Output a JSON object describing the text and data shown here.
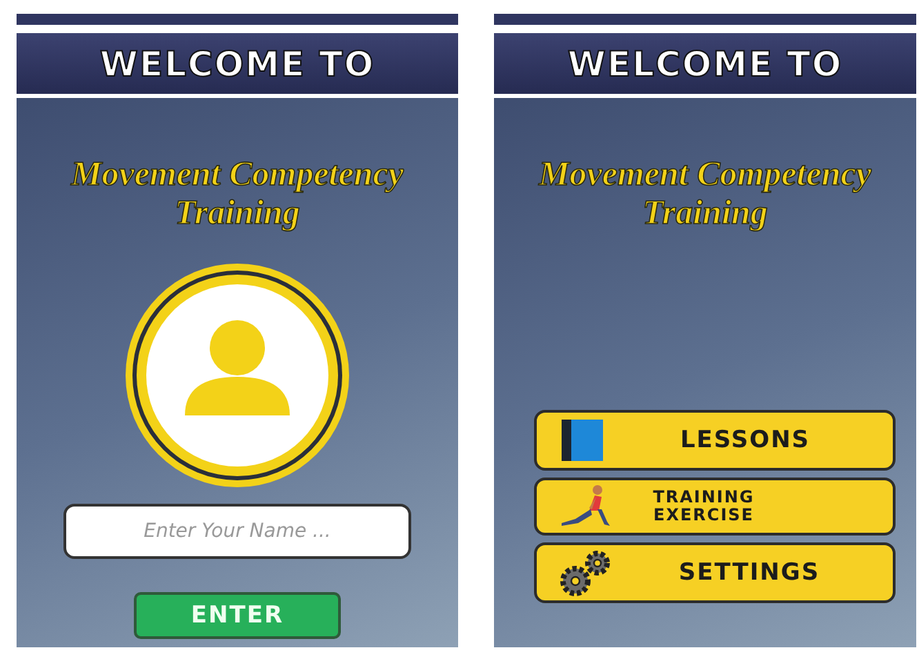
{
  "screens": [
    {
      "kind": "login",
      "header": "WELCOME TO",
      "title_lines": [
        "Movement Competency",
        "Training"
      ],
      "name_field": {
        "placeholder": "Enter Your Name ..."
      },
      "enter_button": "ENTER"
    },
    {
      "kind": "menu",
      "header": "WELCOME TO",
      "title_lines": [
        "Movement Competency",
        "Training"
      ],
      "menu": [
        {
          "label": "LESSONS",
          "kind": "book"
        },
        {
          "label": "TRAINING EXERCISE",
          "kind": "runner"
        },
        {
          "label": "SETTINGS",
          "kind": "gears"
        }
      ]
    }
  ]
}
